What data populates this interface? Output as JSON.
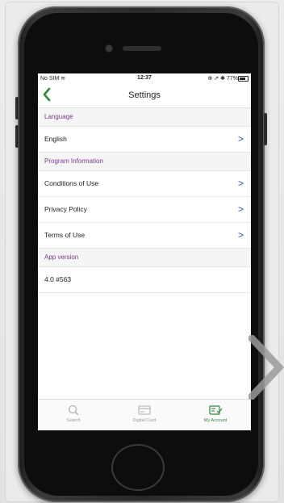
{
  "status_bar": {
    "carrier": "No SIM",
    "time": "12:37",
    "battery_percent": "77%"
  },
  "nav": {
    "title": "Settings",
    "back_icon": "chevron-left-icon"
  },
  "sections": [
    {
      "header": "Language",
      "rows": [
        {
          "label": "English",
          "chevron": ">"
        }
      ]
    },
    {
      "header": "Program Information",
      "rows": [
        {
          "label": "Conditions of Use",
          "chevron": ">"
        },
        {
          "label": "Privacy Policy",
          "chevron": ">"
        },
        {
          "label": "Terms of Use",
          "chevron": ">"
        }
      ]
    },
    {
      "header": "App version",
      "rows": [
        {
          "label": "4.0 #563"
        }
      ]
    }
  ],
  "tabs": [
    {
      "label": "Search",
      "icon": "search-icon",
      "active": false
    },
    {
      "label": "Digital Card",
      "icon": "card-icon",
      "active": false
    },
    {
      "label": "My Account",
      "icon": "account-icon",
      "active": true
    }
  ],
  "colors": {
    "accent": "#2e8a3a",
    "section_header_text": "#7a3a8c",
    "chevron": "#2a5b9a"
  }
}
